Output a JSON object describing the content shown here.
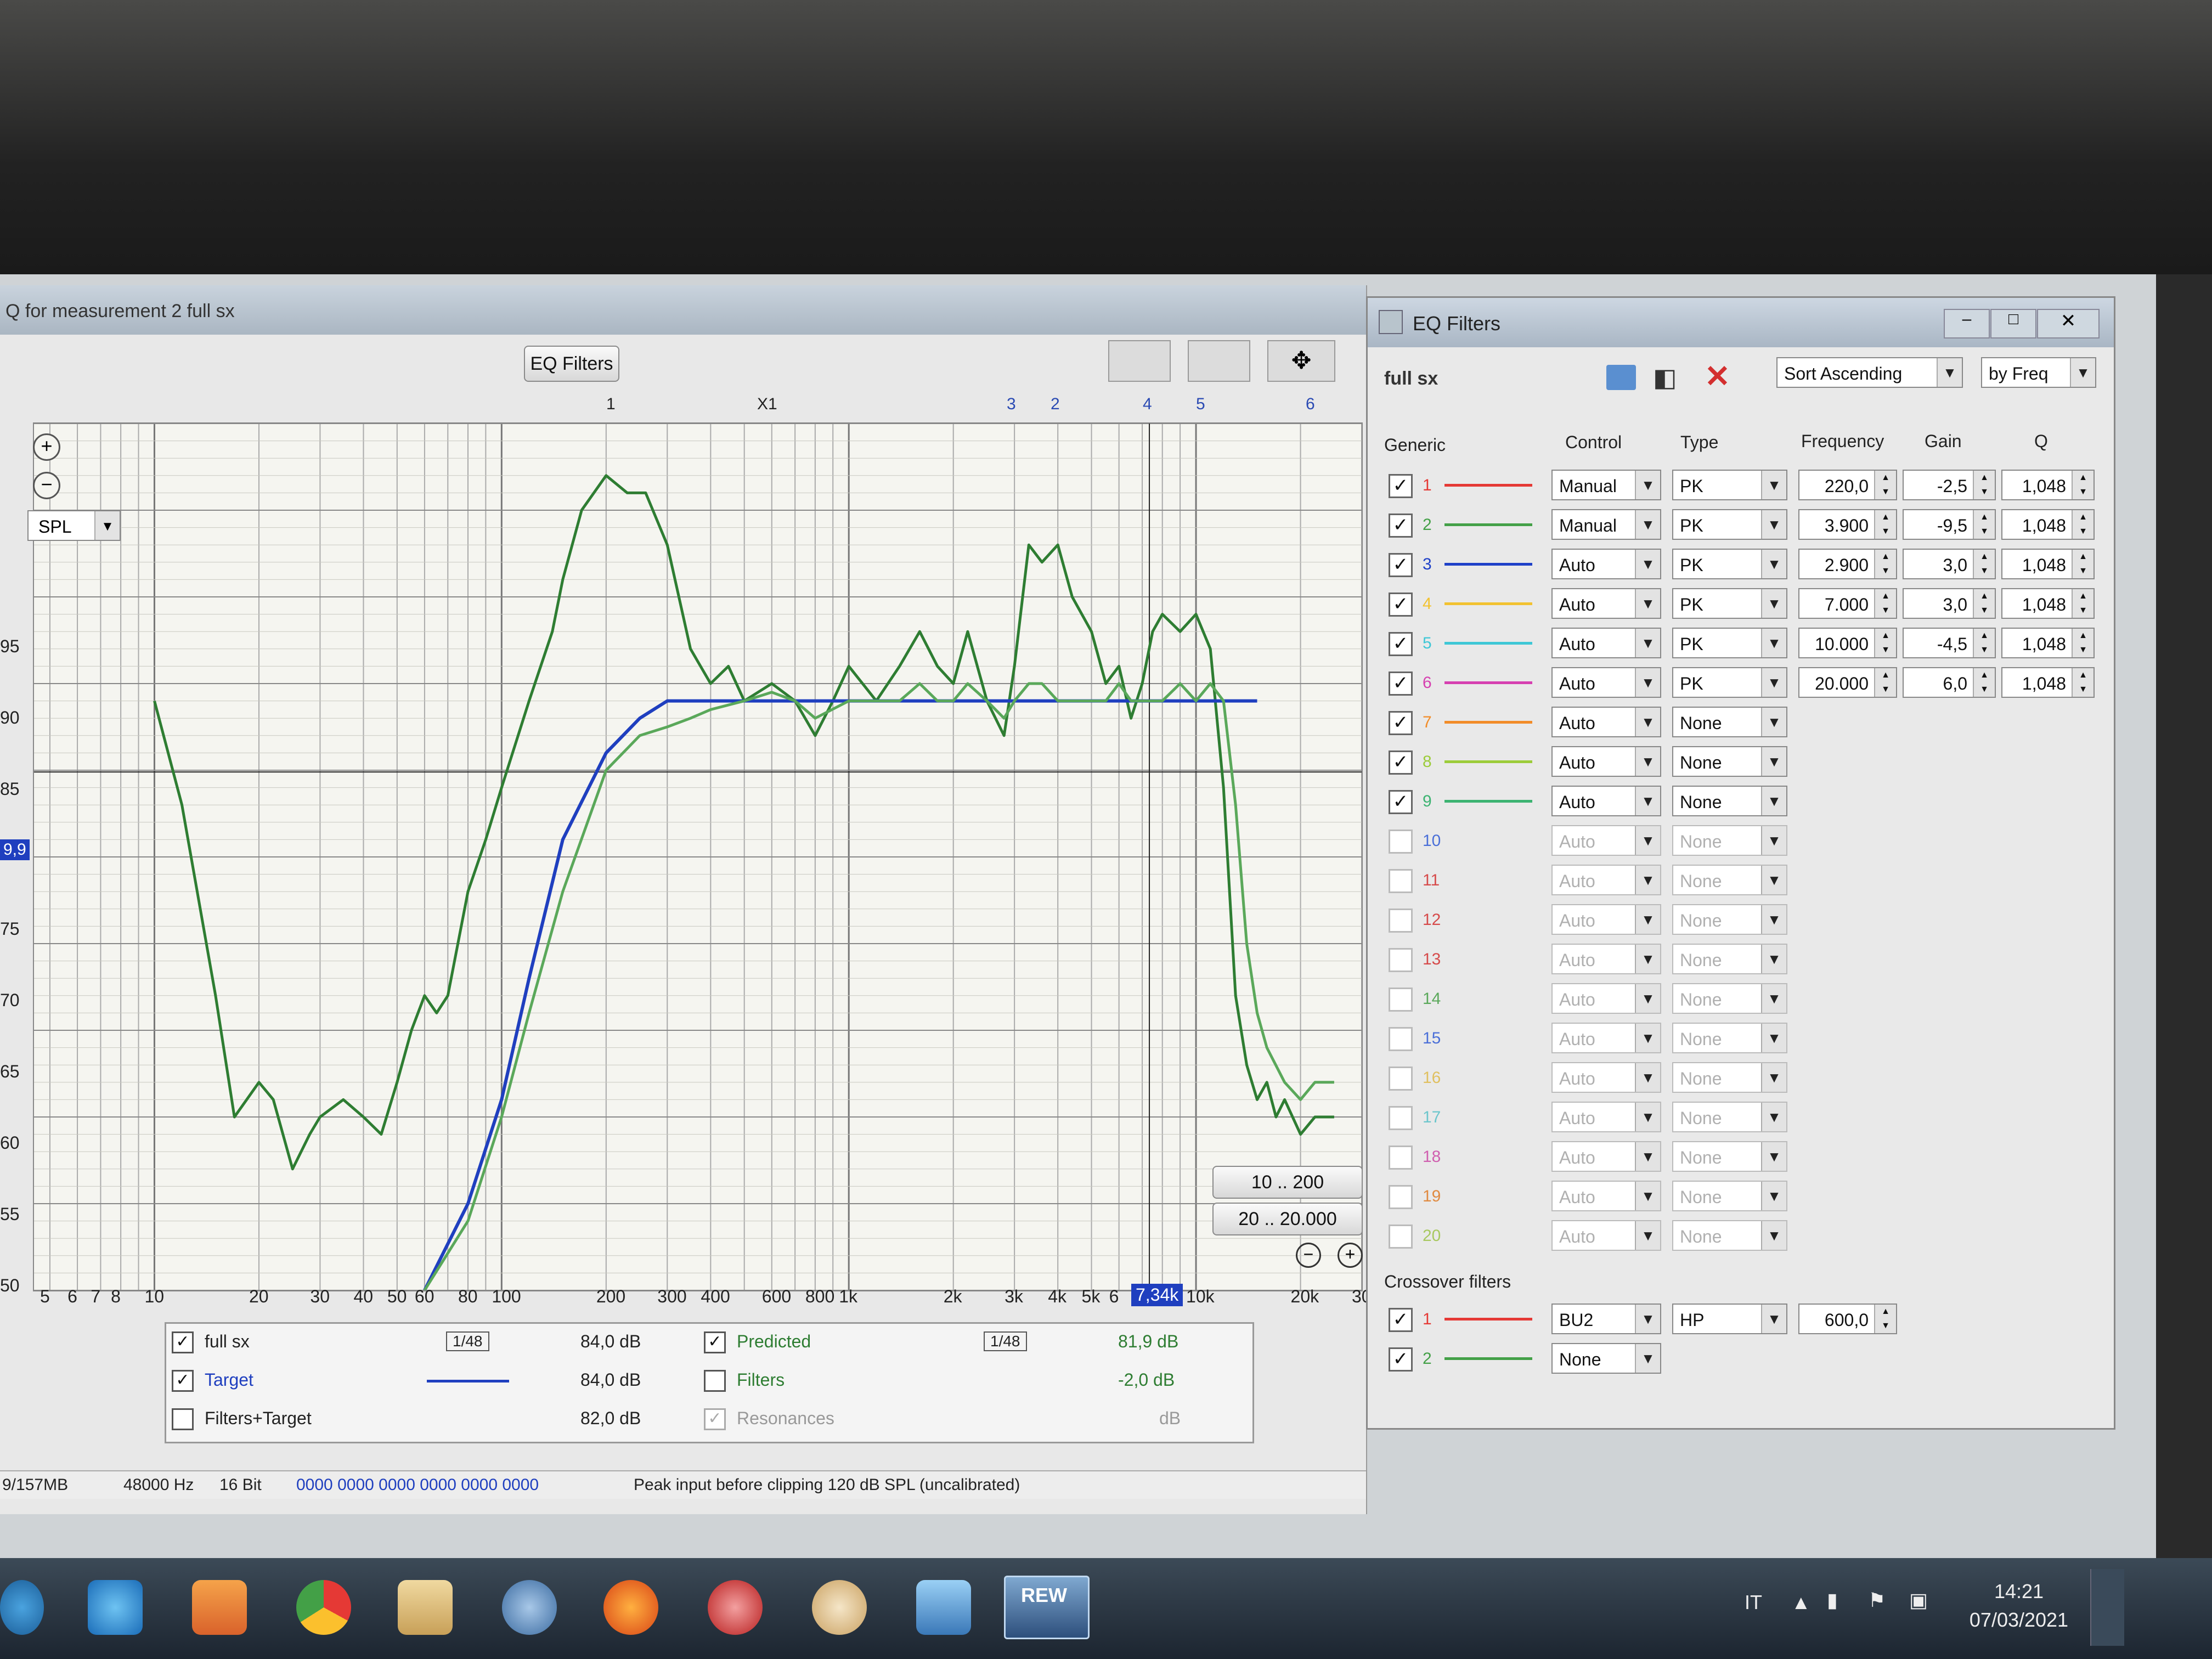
{
  "main_window": {
    "title": "Q for measurement 2 full sx",
    "eq_filters_button": "EQ Filters",
    "spl_select": "SPL",
    "zoom_in": "+",
    "zoom_out": "−",
    "band_markers": [
      "1",
      "X1",
      "3",
      "2",
      "4",
      "5",
      "6"
    ],
    "y_ticks": [
      "95",
      "90",
      "85",
      "75",
      "70",
      "65",
      "60",
      "55",
      "50"
    ],
    "y_cursor": "9,9",
    "x_ticks": [
      "5",
      "6",
      "7",
      "8",
      "10",
      "20",
      "30",
      "40",
      "50",
      "60",
      "80",
      "100",
      "200",
      "300",
      "400",
      "600",
      "800",
      "1k",
      "2k",
      "3k",
      "4k",
      "5k",
      "6",
      "10k",
      "20k",
      "30"
    ],
    "x_cursor": "7,34k",
    "range_buttons": [
      "10 .. 200",
      "20 .. 20.000"
    ],
    "legend": [
      {
        "label": "full sx",
        "checked": true,
        "smoothing": "1/48",
        "value": "84,0 dB"
      },
      {
        "label": "Target",
        "checked": true,
        "smoothing": "",
        "value": "84,0 dB"
      },
      {
        "label": "Filters+Target",
        "checked": false,
        "smoothing": "",
        "value": "82,0 dB"
      },
      {
        "label": "Predicted",
        "checked": true,
        "smoothing": "1/48",
        "value": "81,9 dB"
      },
      {
        "label": "Filters",
        "checked": false,
        "smoothing": "",
        "value": "-2,0 dB"
      },
      {
        "label": "Resonances",
        "checked": true,
        "smoothing": "",
        "value": "dB"
      }
    ],
    "status": {
      "memory": "9/157MB",
      "rate": "48000 Hz",
      "bits": "16 Bit",
      "levels": "0000 0000  0000 0000  0000 0000",
      "message": "Peak input before clipping 120 dB SPL (uncalibrated)"
    }
  },
  "chart_data": {
    "type": "line",
    "xlabel": "",
    "ylabel": "",
    "x_scale": "log",
    "xlim": [
      4.5,
      30000
    ],
    "ylim": [
      50,
      100
    ],
    "series": [
      {
        "name": "full sx",
        "color": "#2e7d32",
        "x": [
          10,
          12,
          15,
          17,
          20,
          22,
          25,
          28,
          30,
          35,
          40,
          45,
          50,
          55,
          60,
          65,
          70,
          80,
          90,
          100,
          120,
          140,
          150,
          170,
          200,
          230,
          260,
          300,
          350,
          400,
          450,
          500,
          600,
          700,
          800,
          900,
          1000,
          1200,
          1400,
          1600,
          1800,
          2000,
          2200,
          2500,
          2800,
          3000,
          3300,
          3600,
          4000,
          4400,
          5000,
          5500,
          6000,
          6500,
          7000,
          7500,
          8000,
          9000,
          10000,
          11000,
          12000,
          13000,
          14000,
          15000,
          16000,
          17000,
          18000,
          20000,
          22000,
          25000
        ],
        "y": [
          84,
          78,
          67,
          60,
          62,
          61,
          57,
          59,
          60,
          61,
          60,
          59,
          62,
          65,
          67,
          66,
          67,
          73,
          76,
          79,
          84,
          88,
          91,
          95,
          97,
          96,
          96,
          93,
          87,
          85,
          86,
          84,
          85,
          84,
          82,
          84,
          86,
          84,
          86,
          88,
          86,
          85,
          88,
          84,
          82,
          86,
          93,
          92,
          93,
          90,
          88,
          85,
          86,
          83,
          85,
          88,
          89,
          88,
          89,
          87,
          79,
          67,
          63,
          61,
          62,
          60,
          61,
          59,
          60,
          60
        ]
      },
      {
        "name": "Target",
        "color": "#1f3fbf",
        "x": [
          60,
          80,
          100,
          120,
          150,
          200,
          250,
          300,
          400,
          500,
          700,
          1000,
          2000,
          5000,
          10000,
          15000
        ],
        "y": [
          50,
          55,
          61,
          68,
          76,
          81,
          83,
          84,
          84,
          84,
          84,
          84,
          84,
          84,
          84,
          84
        ]
      },
      {
        "name": "Predicted",
        "color": "#5aa85a",
        "x": [
          60,
          80,
          100,
          120,
          150,
          200,
          250,
          300,
          350,
          400,
          500,
          600,
          700,
          800,
          1000,
          1200,
          1400,
          1600,
          1800,
          2000,
          2200,
          2500,
          2800,
          3000,
          3300,
          3600,
          4000,
          4400,
          5000,
          5500,
          6000,
          6500,
          7000,
          8000,
          9000,
          10000,
          11000,
          12000,
          13000,
          14000,
          15000,
          16000,
          18000,
          20000,
          22000,
          25000
        ],
        "y": [
          50,
          54,
          60,
          66,
          73,
          80,
          82,
          82.5,
          83,
          83.5,
          84,
          84.5,
          84,
          83,
          84,
          84,
          84,
          85,
          84,
          84,
          85,
          84,
          83,
          84,
          85,
          85,
          84,
          84,
          84,
          84,
          85,
          84,
          84,
          84,
          85,
          84,
          85,
          84,
          78,
          70,
          66,
          64,
          62,
          61,
          62,
          62
        ]
      }
    ]
  },
  "eq_dialog": {
    "title": "EQ Filters",
    "measurement": "full sx",
    "sort": "Sort Ascending",
    "sort_by": "by Freq",
    "headers": {
      "generic": "Generic",
      "control": "Control",
      "type": "Type",
      "frequency": "Frequency",
      "gain": "Gain",
      "q": "Q"
    },
    "filters": [
      {
        "n": "1",
        "on": true,
        "color": "#e53935",
        "control": "Manual",
        "type": "PK",
        "freq": "220,0",
        "gain": "-2,5",
        "q": "1,048",
        "enabled": true
      },
      {
        "n": "2",
        "on": true,
        "color": "#43a047",
        "control": "Manual",
        "type": "PK",
        "freq": "3.900",
        "gain": "-9,5",
        "q": "1,048",
        "enabled": true
      },
      {
        "n": "3",
        "on": true,
        "color": "#1e40c8",
        "control": "Auto",
        "type": "PK",
        "freq": "2.900",
        "gain": "3,0",
        "q": "1,048",
        "enabled": true
      },
      {
        "n": "4",
        "on": true,
        "color": "#f2c230",
        "control": "Auto",
        "type": "PK",
        "freq": "7.000",
        "gain": "3,0",
        "q": "1,048",
        "enabled": true
      },
      {
        "n": "5",
        "on": true,
        "color": "#3ec7d6",
        "control": "Auto",
        "type": "PK",
        "freq": "10.000",
        "gain": "-4,5",
        "q": "1,048",
        "enabled": true
      },
      {
        "n": "6",
        "on": true,
        "color": "#d63fb0",
        "control": "Auto",
        "type": "PK",
        "freq": "20.000",
        "gain": "6,0",
        "q": "1,048",
        "enabled": true
      },
      {
        "n": "7",
        "on": true,
        "color": "#f28c28",
        "control": "Auto",
        "type": "None",
        "freq": "",
        "gain": "",
        "q": "",
        "enabled": true
      },
      {
        "n": "8",
        "on": true,
        "color": "#9ccc3a",
        "control": "Auto",
        "type": "None",
        "freq": "",
        "gain": "",
        "q": "",
        "enabled": true
      },
      {
        "n": "9",
        "on": true,
        "color": "#3cb371",
        "control": "Auto",
        "type": "None",
        "freq": "",
        "gain": "",
        "q": "",
        "enabled": true
      },
      {
        "n": "10",
        "on": false,
        "color": "#4a6fd8",
        "control": "Auto",
        "type": "None",
        "freq": "",
        "gain": "",
        "q": "",
        "enabled": false
      },
      {
        "n": "11",
        "on": false,
        "color": "#d64a4a",
        "control": "Auto",
        "type": "None",
        "freq": "",
        "gain": "",
        "q": "",
        "enabled": false
      },
      {
        "n": "12",
        "on": false,
        "color": "#d64a4a",
        "control": "Auto",
        "type": "None",
        "freq": "",
        "gain": "",
        "q": "",
        "enabled": false
      },
      {
        "n": "13",
        "on": false,
        "color": "#d64a4a",
        "control": "Auto",
        "type": "None",
        "freq": "",
        "gain": "",
        "q": "",
        "enabled": false
      },
      {
        "n": "14",
        "on": false,
        "color": "#5aa85a",
        "control": "Auto",
        "type": "None",
        "freq": "",
        "gain": "",
        "q": "",
        "enabled": false
      },
      {
        "n": "15",
        "on": false,
        "color": "#4a6fd8",
        "control": "Auto",
        "type": "None",
        "freq": "",
        "gain": "",
        "q": "",
        "enabled": false
      },
      {
        "n": "16",
        "on": false,
        "color": "#e0c060",
        "control": "Auto",
        "type": "None",
        "freq": "",
        "gain": "",
        "q": "",
        "enabled": false
      },
      {
        "n": "17",
        "on": false,
        "color": "#6cc6cc",
        "control": "Auto",
        "type": "None",
        "freq": "",
        "gain": "",
        "q": "",
        "enabled": false
      },
      {
        "n": "18",
        "on": false,
        "color": "#d060b0",
        "control": "Auto",
        "type": "None",
        "freq": "",
        "gain": "",
        "q": "",
        "enabled": false
      },
      {
        "n": "19",
        "on": false,
        "color": "#e08a40",
        "control": "Auto",
        "type": "None",
        "freq": "",
        "gain": "",
        "q": "",
        "enabled": false
      },
      {
        "n": "20",
        "on": false,
        "color": "#a8c860",
        "control": "Auto",
        "type": "None",
        "freq": "",
        "gain": "",
        "q": "",
        "enabled": false
      }
    ],
    "crossover_label": "Crossover filters",
    "crossovers": [
      {
        "n": "1",
        "on": true,
        "color": "#e53935",
        "type": "BU2",
        "mode": "HP",
        "freq": "600,0"
      },
      {
        "n": "2",
        "on": true,
        "color": "#43a047",
        "type": "None",
        "mode": "",
        "freq": ""
      }
    ]
  },
  "taskbar": {
    "lang": "IT",
    "time": "14:21",
    "date": "07/03/2021",
    "rew_label": "REW"
  }
}
